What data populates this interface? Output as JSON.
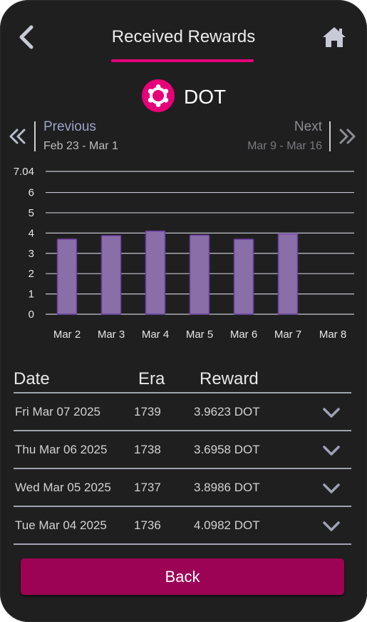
{
  "header": {
    "title": "Received Rewards",
    "back_icon": "chevron-left-icon",
    "home_icon": "home-icon"
  },
  "token": {
    "name": "DOT",
    "logo_icon": "polkadot-logo-icon",
    "brand_color": "#e6007a"
  },
  "nav": {
    "previous_label": "Previous",
    "previous_range": "Feb 23 - Mar 1",
    "next_label": "Next",
    "next_range": "Mar 9 - Mar 16",
    "previous_icon": "double-chevron-left-icon",
    "next_icon": "double-chevron-right-icon"
  },
  "chart_data": {
    "type": "bar",
    "categories": [
      "Mar 2",
      "Mar 3",
      "Mar 4",
      "Mar 5",
      "Mar 6",
      "Mar 7",
      "Mar 8"
    ],
    "values": [
      3.7,
      3.87,
      4.0982,
      3.8986,
      3.6958,
      3.9623,
      null
    ],
    "ylim": [
      0,
      7.04
    ],
    "yticks": [
      "0",
      "1",
      "2",
      "3",
      "4",
      "5",
      "6",
      "7.04"
    ],
    "grid": true,
    "bar_fill": "#8a6ea8",
    "bar_stroke": "#6b3fa0"
  },
  "table": {
    "headers": [
      "Date",
      "Era",
      "Reward"
    ],
    "rows": [
      {
        "date": "Fri Mar 07 2025",
        "era": "1739",
        "reward": "3.9623 DOT"
      },
      {
        "date": "Thu Mar 06 2025",
        "era": "1738",
        "reward": "3.6958 DOT"
      },
      {
        "date": "Wed Mar 05 2025",
        "era": "1737",
        "reward": "3.8986 DOT"
      },
      {
        "date": "Tue Mar 04 2025",
        "era": "1736",
        "reward": "4.0982 DOT"
      }
    ],
    "row_icon": "chevron-down-icon"
  },
  "footer": {
    "back_label": "Back",
    "button_color": "#9c0355"
  }
}
